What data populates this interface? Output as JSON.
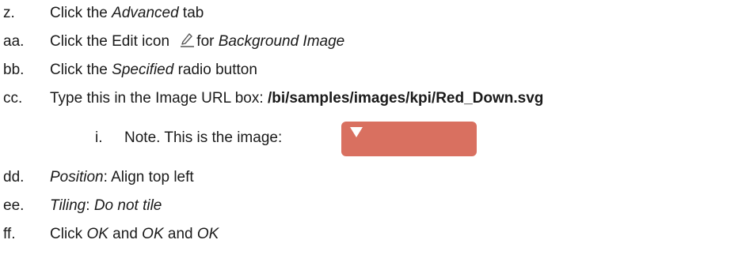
{
  "steps": [
    {
      "marker": "z.",
      "parts": [
        "Click the ",
        "Advanced",
        " tab"
      ]
    },
    {
      "marker": "aa.",
      "parts": [
        "Click the Edit icon ",
        "for ",
        "Background Image"
      ],
      "icon": "pencil-edit-icon"
    },
    {
      "marker": "bb.",
      "parts": [
        "Click the ",
        "Specified",
        " radio button"
      ]
    },
    {
      "marker": "cc.",
      "parts": [
        "Type this in the Image URL box: ",
        "/bi/samples/images/kpi/Red_Down.svg"
      ]
    },
    {
      "marker": "i.",
      "parts": [
        "Note. This is the image:"
      ],
      "image": {
        "name": "red-down-image",
        "background": "#d97060",
        "arrow_color": "#ffffff"
      }
    },
    {
      "marker": "dd.",
      "parts": [
        "Position",
        ": Align top left"
      ]
    },
    {
      "marker": "ee.",
      "parts": [
        "Tiling",
        ": ",
        "Do not tile"
      ]
    },
    {
      "marker": "ff.",
      "parts": [
        "Click ",
        "OK",
        " and ",
        "OK",
        " and ",
        "OK"
      ]
    }
  ]
}
